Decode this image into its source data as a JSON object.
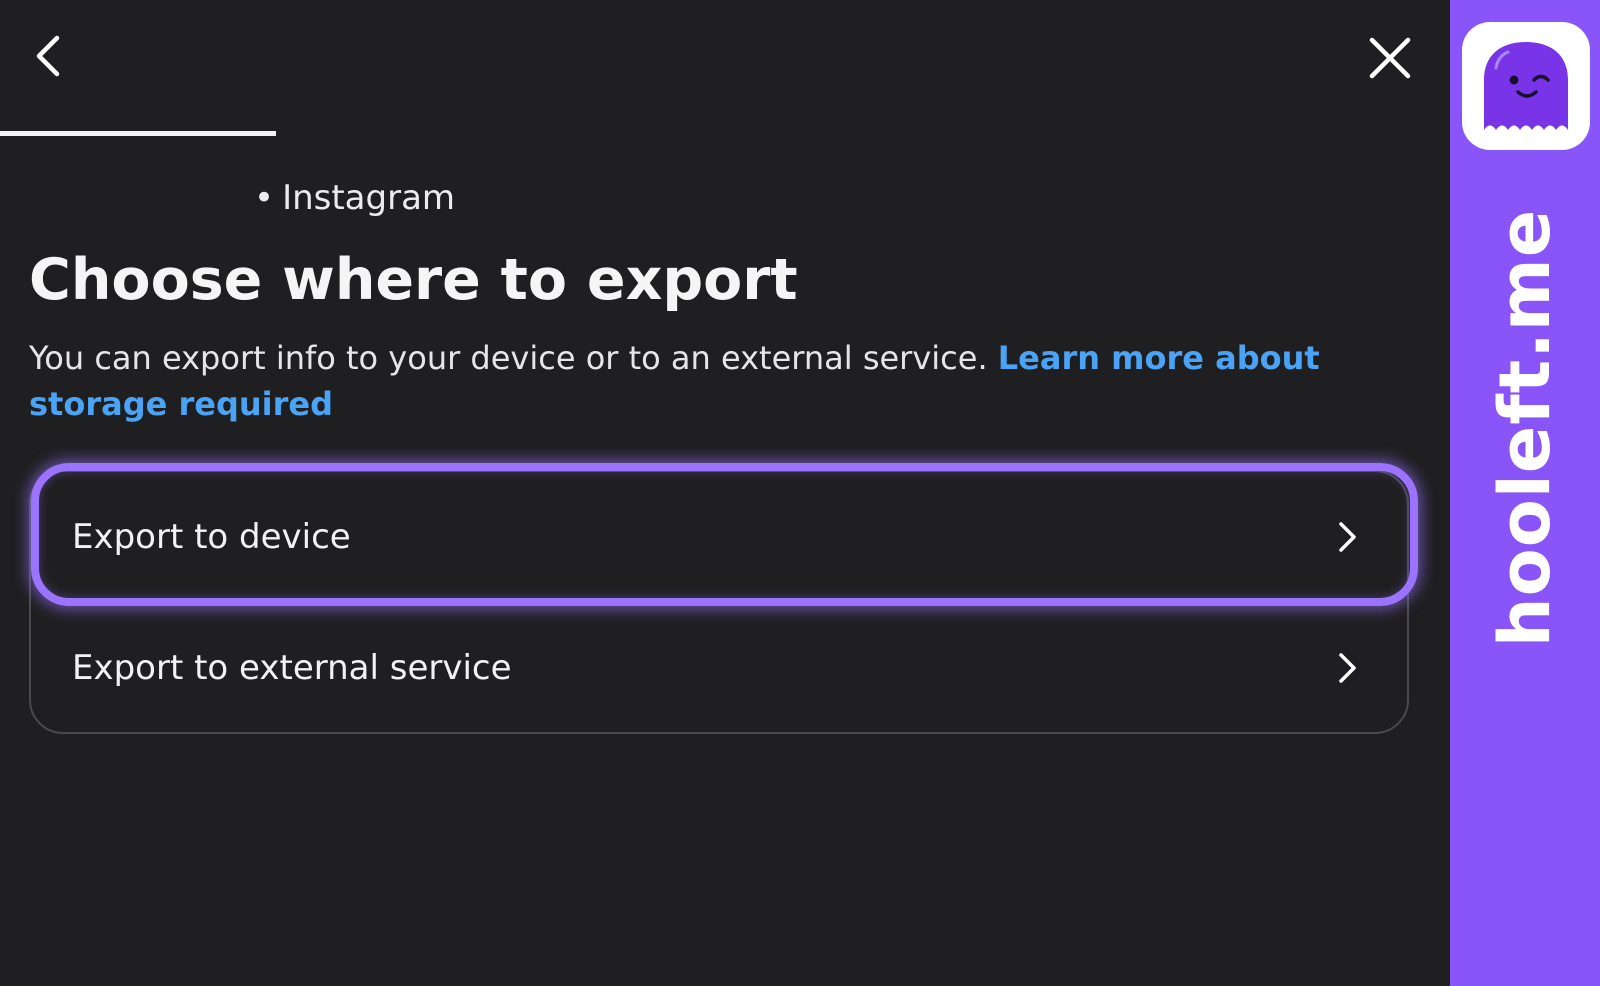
{
  "header": {
    "back_icon": "chevron-left-icon",
    "close_icon": "close-icon",
    "progress": 0.19
  },
  "account": {
    "bullet": "•",
    "platform": "Instagram"
  },
  "page": {
    "title": "Choose where to export",
    "description": "You can export info to your device or to an external service.",
    "link_text": "Learn more about storage required"
  },
  "options": [
    {
      "label": "Export to device",
      "icon": "chevron-right-icon"
    },
    {
      "label": "Export to external service",
      "icon": "chevron-right-icon"
    }
  ],
  "highlight_color": "#9b73ff",
  "link_color": "#4ba3f5",
  "brand": {
    "name": "hooleft.me",
    "color": "#8a55f8",
    "logo_icon": "purple-ghost-winking-logo"
  }
}
